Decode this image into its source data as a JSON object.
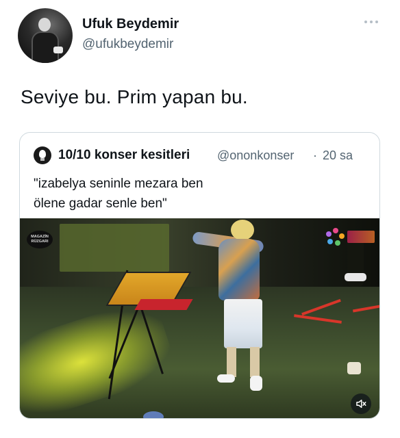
{
  "author": {
    "name": "Ufuk Beydemir",
    "handle": "@ufukbeydemir"
  },
  "tweet": {
    "text": "Seviye bu. Prim yapan bu."
  },
  "icons": {
    "more": "more-horizontal-icon",
    "mute": "volume-muted-icon"
  },
  "quoted_tweet": {
    "author_name": "10/10 konser kesitleri",
    "author_handle": "@ononkonser",
    "separator": "·",
    "time": "20 sa",
    "text_lines": [
      "\"izabelya seninle mezara ben",
      "ölene gadar senle ben\""
    ],
    "video": {
      "watermark_left": "MAGAZİN RÜZGARI"
    }
  },
  "colors": {
    "text_primary": "#0f1419",
    "text_secondary": "#536471",
    "border": "#cfd9de"
  }
}
